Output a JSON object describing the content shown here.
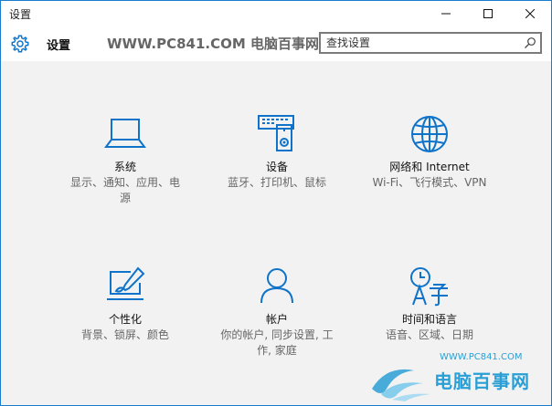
{
  "window": {
    "title": "设置"
  },
  "header": {
    "title": "设置",
    "watermark": "WWW.PC841.COM 电脑百事网",
    "search_placeholder": "查找设置",
    "search_value": ""
  },
  "colors": {
    "accent": "#0f73c9",
    "background": "#f2f2f2",
    "watermark": "#2a9fd6"
  },
  "tiles": [
    {
      "name": "系统",
      "desc1": "显示、通知、应用、电",
      "desc2": "源",
      "icon": "laptop-icon"
    },
    {
      "name": "设备",
      "desc1": "蓝牙、打印机、鼠标",
      "desc2": "",
      "icon": "devices-icon"
    },
    {
      "name": "网络和 Internet",
      "desc1": "Wi-Fi、飞行模式、VPN",
      "desc2": "",
      "icon": "globe-icon"
    },
    {
      "name": "个性化",
      "desc1": "背景、锁屏、颜色",
      "desc2": "",
      "icon": "personalization-icon"
    },
    {
      "name": "帐户",
      "desc1": "你的帐户, 同步设置, 工",
      "desc2": "作, 家庭",
      "icon": "person-icon"
    },
    {
      "name": "时间和语言",
      "desc1": "语音、区域、日期",
      "desc2": "",
      "icon": "time-language-icon"
    }
  ],
  "logo_watermark": {
    "url": "WWW.PC841.COM",
    "text": "电脑百事网"
  }
}
